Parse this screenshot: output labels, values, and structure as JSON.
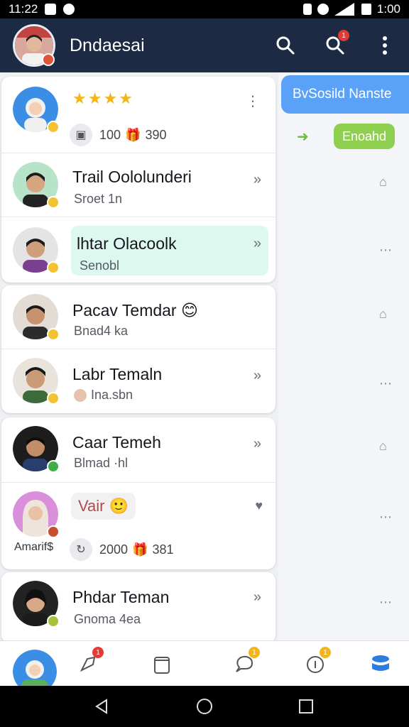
{
  "status_bar": {
    "time": "11:22",
    "clock_right": "1:00"
  },
  "app_bar": {
    "title": "Dndaesai",
    "notification_badge": "1"
  },
  "colors": {
    "appbar": "#1c2a44",
    "accent_blue": "#5aa2f7",
    "accent_green": "#8fcf4f",
    "highlight": "#ddf8ee"
  },
  "chats": [
    {
      "stars": "★★★★",
      "meta_count": "100",
      "meta_extra": "390"
    },
    {
      "name": "Trail Oololunderi",
      "sub": "Sroet 1n"
    },
    {
      "name": "lhtar Olacoolk",
      "sub": "Senobl",
      "highlighted": true
    },
    {
      "name": "Pacav Temdar 😊",
      "sub": "Bnad4 ka"
    },
    {
      "name": "Labr Temaln",
      "sub": "Ina.sbn"
    },
    {
      "name": "Caar Temeh",
      "sub": "Blmad ·hl"
    },
    {
      "name": "Vair 🙂",
      "caption": "Amarif$",
      "meta_count": "2000",
      "meta_extra": "381"
    },
    {
      "name": "Phdar Teman",
      "sub": "Gnoma 4ea"
    }
  ],
  "right_panel": {
    "header": "BvSosild Nanste",
    "pill": "Enoahd"
  },
  "bottom_nav": {
    "badges": [
      "1",
      "1",
      "1"
    ]
  }
}
